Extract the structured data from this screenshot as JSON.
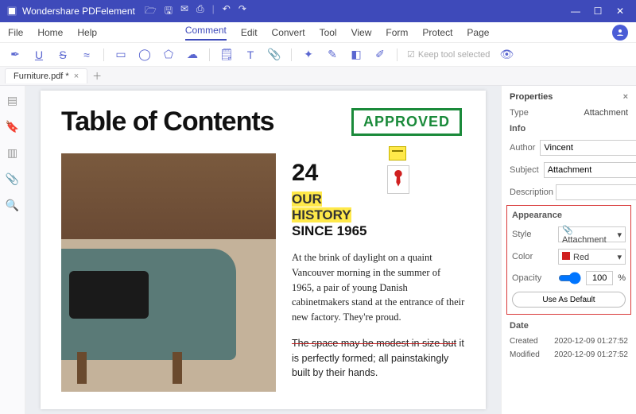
{
  "titlebar": {
    "app_name": "Wondershare PDFelement"
  },
  "menu": {
    "items": [
      "File",
      "Home",
      "Help",
      "Comment",
      "Edit",
      "Convert",
      "Tool",
      "View",
      "Form",
      "Protect",
      "Page"
    ],
    "active_index": 3
  },
  "toolbar": {
    "keep_tool_label": "Keep tool selected"
  },
  "tabs": {
    "items": [
      {
        "title": "Furniture.pdf *"
      }
    ]
  },
  "doc": {
    "heading": "Table of Contents",
    "stamp": "APPROVED",
    "number": "24",
    "hist1": "OUR",
    "hist2": "HISTORY",
    "since": "SINCE 1965",
    "para1": "At the brink of daylight on a quaint Vancouver morning in the summer of 1965, a pair of young Danish cabinetmakers stand at the entrance of their new factory. They're proud.",
    "para2a": "The space may be modest in size but",
    "para2b": " it is perfectly formed; all painstakingly built by their hands."
  },
  "props": {
    "panel_title": "Properties",
    "type_label": "Type",
    "type_value": "Attachment",
    "info_label": "Info",
    "author_label": "Author",
    "author_value": "Vincent",
    "subject_label": "Subject",
    "subject_value": "Attachment",
    "description_label": "Description",
    "description_value": "",
    "appearance_label": "Appearance",
    "style_label": "Style",
    "style_value": "Attachment",
    "color_label": "Color",
    "color_value": "Red",
    "opacity_label": "Opacity",
    "opacity_value": "100",
    "opacity_unit": "%",
    "default_btn": "Use As Default",
    "date_label": "Date",
    "created_label": "Created",
    "created_value": "2020-12-09 01:27:52",
    "modified_label": "Modified",
    "modified_value": "2020-12-09 01:27:52"
  }
}
